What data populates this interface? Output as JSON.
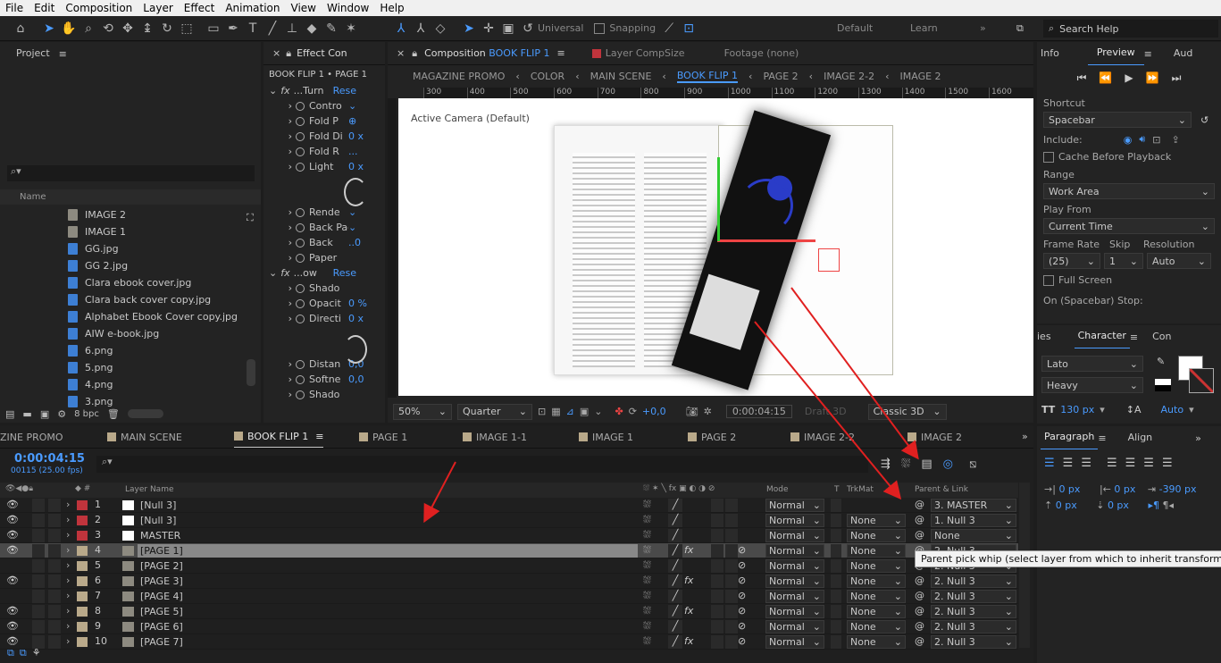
{
  "menu": [
    "File",
    "Edit",
    "Composition",
    "Layer",
    "Effect",
    "Animation",
    "View",
    "Window",
    "Help"
  ],
  "toolbar": {
    "universal": "Universal",
    "snapping": "Snapping",
    "workspaces": [
      "Default",
      "Learn"
    ],
    "search": "Search Help"
  },
  "project": {
    "title": "Project",
    "col_name": "Name",
    "items": [
      {
        "name": "IMAGE 2",
        "type": "comp"
      },
      {
        "name": "IMAGE 1",
        "type": "comp"
      },
      {
        "name": "GG.jpg",
        "type": "file"
      },
      {
        "name": "GG 2.jpg",
        "type": "file"
      },
      {
        "name": "Clara ebook cover.jpg",
        "type": "file"
      },
      {
        "name": "Clara back cover copy.jpg",
        "type": "file"
      },
      {
        "name": "Alphabet Ebook Cover copy.jpg",
        "type": "file"
      },
      {
        "name": "AIW e-book.jpg",
        "type": "file"
      },
      {
        "name": "6.png",
        "type": "file"
      },
      {
        "name": "5.png",
        "type": "file"
      },
      {
        "name": "4.png",
        "type": "file"
      },
      {
        "name": "3.png",
        "type": "file"
      }
    ],
    "bpc": "8 bpc"
  },
  "effects": {
    "title": "Effect Con",
    "subtitle": "BOOK FLIP 1 • PAGE 1",
    "rows": [
      {
        "label": "...Turn",
        "val": "Rese",
        "fx": true
      },
      {
        "label": "Contro",
        "val": "⌄"
      },
      {
        "label": "Fold P",
        "val": "⊕"
      },
      {
        "label": "Fold Di",
        "val": "0 x"
      },
      {
        "label": "Fold R",
        "val": "..."
      },
      {
        "label": "Light",
        "val": "0 x"
      },
      {
        "label": "Rende",
        "val": "⌄"
      },
      {
        "label": "Back Page",
        "val": "⌄"
      },
      {
        "label": "Back",
        "val": "..0"
      },
      {
        "label": "Paper",
        "val": ""
      },
      {
        "label": "...ow",
        "val": "Rese",
        "fx": true
      },
      {
        "label": "Shado",
        "val": ""
      },
      {
        "label": "Opacit",
        "val": "0 %"
      },
      {
        "label": "Directi",
        "val": "0 x"
      },
      {
        "label": "Distan",
        "val": "0,0"
      },
      {
        "label": "Softne",
        "val": "0,0"
      },
      {
        "label": "Shado",
        "val": ""
      }
    ]
  },
  "comp": {
    "tab": "Composition",
    "tab_name": "BOOK FLIP 1",
    "layer": "Layer CompSize",
    "footage": "Footage (none)",
    "breadcrumbs": [
      "MAGAZINE PROMO",
      "COLOR",
      "MAIN SCENE",
      "BOOK FLIP 1",
      "PAGE 2",
      "IMAGE 2-2",
      "IMAGE 2"
    ],
    "ruler": [
      "300",
      "400",
      "500",
      "600",
      "700",
      "800",
      "900",
      "1000",
      "1100",
      "1200",
      "1300",
      "1400",
      "1500",
      "1600"
    ],
    "camera": "Active Camera (Default)",
    "zoom": "50%",
    "quality": "Quarter",
    "exposure": "+0,0",
    "time": "0:00:04:15",
    "draft": "Draft 3D",
    "renderer": "Classic 3D"
  },
  "preview": {
    "tabs": [
      "Info",
      "Preview",
      "Aud"
    ],
    "shortcut_label": "Shortcut",
    "shortcut": "Spacebar",
    "include": "Include:",
    "cache": "Cache Before Playback",
    "range_label": "Range",
    "range": "Work Area",
    "playfrom_label": "Play From",
    "playfrom": "Current Time",
    "framerate_label": "Frame Rate",
    "skip_label": "Skip",
    "resolution_label": "Resolution",
    "framerate": "(25)",
    "skip": "1",
    "resolution": "Auto",
    "fullscreen": "Full Screen",
    "stop": "On (Spacebar) Stop:"
  },
  "character": {
    "tabs": [
      "ies",
      "Character",
      "Con"
    ],
    "font": "Lato",
    "style": "Heavy",
    "size": "130 px",
    "leading": "Auto"
  },
  "paragraph": {
    "tabs": [
      "Paragraph",
      "Align"
    ],
    "v1": "0 px",
    "v2": "0 px",
    "v3": "-390 px",
    "v4": "0 px",
    "v5": "0 px"
  },
  "timeline": {
    "tabs": [
      "ZINE PROMO",
      "MAIN SCENE",
      "BOOK FLIP 1",
      "PAGE 1",
      "IMAGE 1-1",
      "IMAGE 1",
      "PAGE 2",
      "IMAGE 2-2",
      "IMAGE 2"
    ],
    "time": "0:00:04:15",
    "fps": "00115 (25.00 fps)",
    "cols": {
      "name": "Layer Name",
      "mode": "Mode",
      "t": "T",
      "trk": "TrkMat",
      "parent": "Parent & Link"
    },
    "layers": [
      {
        "num": "1",
        "name": "[Null 3]",
        "color": "#c0343c",
        "mode": "Normal",
        "trk": "",
        "parent": "3. MASTER",
        "fx": false,
        "eye": true
      },
      {
        "num": "2",
        "name": "[Null 3]",
        "color": "#c0343c",
        "mode": "Normal",
        "trk": "None",
        "parent": "1. Null 3",
        "fx": false,
        "eye": true
      },
      {
        "num": "3",
        "name": "MASTER",
        "color": "#c0343c",
        "mode": "Normal",
        "trk": "None",
        "parent": "None",
        "fx": false,
        "eye": true
      },
      {
        "num": "4",
        "name": "[PAGE 1]",
        "color": "#b9a98a",
        "mode": "Normal",
        "trk": "None",
        "parent": "2. Null 3",
        "fx": true,
        "eye": true,
        "selected": true
      },
      {
        "num": "5",
        "name": "[PAGE 2]",
        "color": "#b9a98a",
        "mode": "Normal",
        "trk": "None",
        "parent": "2. Null 3",
        "fx": false,
        "eye": false
      },
      {
        "num": "6",
        "name": "[PAGE 3]",
        "color": "#b9a98a",
        "mode": "Normal",
        "trk": "None",
        "parent": "2. Null 3",
        "fx": true,
        "eye": true
      },
      {
        "num": "7",
        "name": "[PAGE 4]",
        "color": "#b9a98a",
        "mode": "Normal",
        "trk": "None",
        "parent": "2. Null 3",
        "fx": false,
        "eye": false
      },
      {
        "num": "8",
        "name": "[PAGE 5]",
        "color": "#b9a98a",
        "mode": "Normal",
        "trk": "None",
        "parent": "2. Null 3",
        "fx": true,
        "eye": true
      },
      {
        "num": "9",
        "name": "[PAGE 6]",
        "color": "#b9a98a",
        "mode": "Normal",
        "trk": "None",
        "parent": "2. Null 3",
        "fx": false,
        "eye": true
      },
      {
        "num": "10",
        "name": "[PAGE 7]",
        "color": "#b9a98a",
        "mode": "Normal",
        "trk": "None",
        "parent": "2. Null 3",
        "fx": true,
        "eye": true
      }
    ],
    "tooltip": "Parent pick whip (select layer from which to inherit transforms)"
  },
  "colors": {
    "accent": "#4a9bff",
    "arrow": "#e02020"
  }
}
